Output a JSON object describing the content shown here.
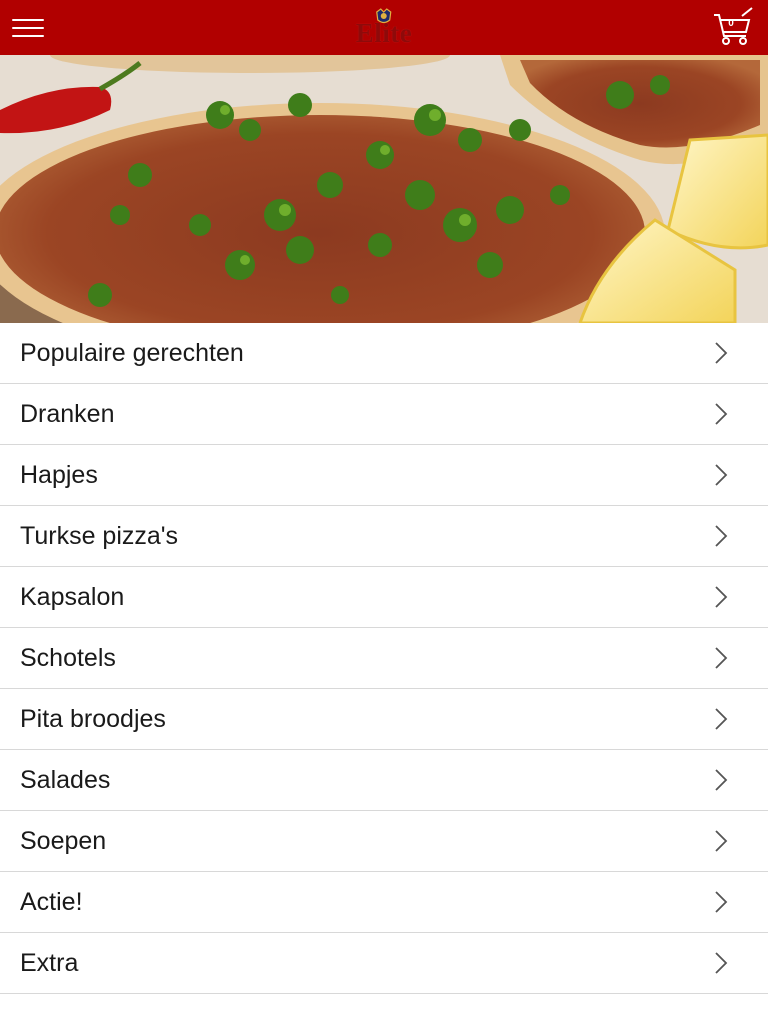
{
  "header": {
    "logo_text": "Elite",
    "menu_icon": "hamburger-menu-icon",
    "cart_icon": "shopping-cart-icon",
    "cart_count": "0",
    "background_color": "#b10000"
  },
  "hero": {
    "image": "lahmacun-turkish-pizza-photo"
  },
  "menu": {
    "items": [
      {
        "label": "Populaire gerechten"
      },
      {
        "label": "Dranken"
      },
      {
        "label": "Hapjes"
      },
      {
        "label": "Turkse pizza's"
      },
      {
        "label": "Kapsalon"
      },
      {
        "label": "Schotels"
      },
      {
        "label": "Pita broodjes"
      },
      {
        "label": "Salades"
      },
      {
        "label": "Soepen"
      },
      {
        "label": "Actie!"
      },
      {
        "label": "Extra"
      }
    ],
    "chevron_icon": "chevron-right-icon"
  }
}
